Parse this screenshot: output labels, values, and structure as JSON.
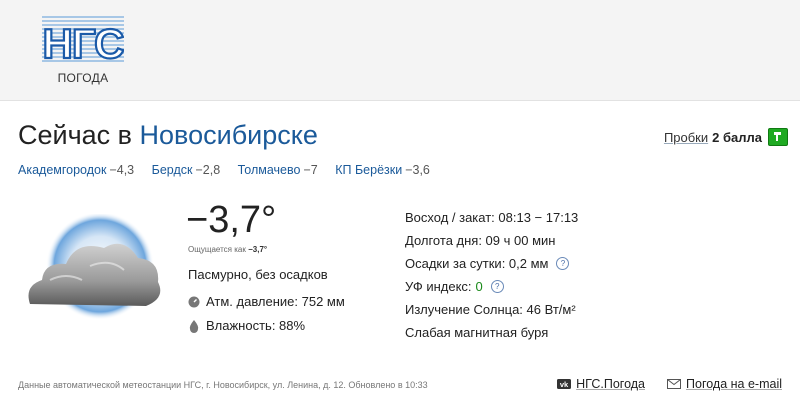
{
  "header": {
    "logo_text": "НГС",
    "logo_sub": "ПОГОДА"
  },
  "title": {
    "prefix": "Сейчас в",
    "city": "Новосибирске"
  },
  "traffic": {
    "label": "Пробки",
    "value": "2 балла",
    "icon": "traffic-flag-icon",
    "color": "#1faa22"
  },
  "cities": [
    {
      "name": "Академгородок",
      "temp": "−4,3"
    },
    {
      "name": "Бердск",
      "temp": "−2,8"
    },
    {
      "name": "Толмачево",
      "temp": "−7"
    },
    {
      "name": "КП Берёзки",
      "temp": "−3,6"
    }
  ],
  "current": {
    "icon": "cloud-icon",
    "temp": "−3,7°",
    "feels_prefix": "Ощущается как",
    "feels_value": "−3,7°",
    "condition": "Пасмурно, без осадков",
    "pressure": "Атм. давление: 752 мм",
    "humidity": "Влажность: 88%"
  },
  "info": {
    "sun": "Восход / закат: 08:13 − 17:13",
    "daylength": "Долгота дня: 09 ч 00 мин",
    "precip": "Осадки за сутки: 0,2 мм",
    "uv_label": "УФ индекс:",
    "uv_value": "0",
    "radiation": "Излучение Солнца: 46  Вт/м²",
    "magnetic": "Слабая магнитная буря",
    "help_glyph": "?"
  },
  "footer": {
    "note": "Данные автоматической метеостанции НГС, г. Новосибирск, ул. Ленина, д. 12. Обновлено в 10:33",
    "vk_label": "НГС.Погода",
    "email_label": "Погода на e-mail"
  }
}
